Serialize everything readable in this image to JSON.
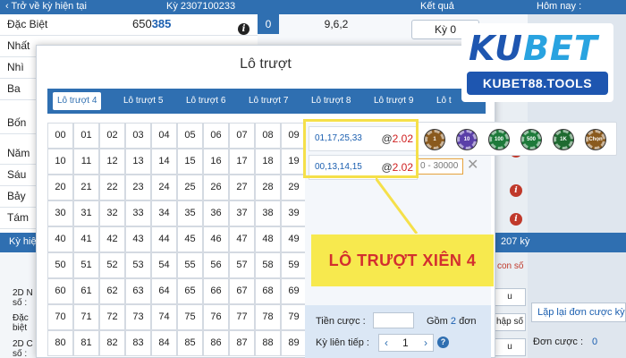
{
  "topbar": {
    "back_label": "Trở về kỳ hiện tại",
    "period_label": "Kỳ 2307100233",
    "result_label": "Kết quả",
    "today_label": "Hôm nay :"
  },
  "results": {
    "rows": [
      {
        "label": "Đặc Biệt",
        "number_plain": "650",
        "number_bold": "385"
      },
      {
        "label": "Nhất",
        "number_plain": "",
        "number_bold": ""
      },
      {
        "label": "Nhì",
        "number_plain": "",
        "number_bold": ""
      },
      {
        "label": "Ba",
        "number_plain": "",
        "number_bold": ""
      },
      {
        "label": "Bốn",
        "number_plain": "",
        "number_bold": ""
      },
      {
        "label": "Năm",
        "number_plain": "",
        "number_bold": ""
      },
      {
        "label": "Sáu",
        "number_plain": "",
        "number_bold": ""
      },
      {
        "label": "Bảy",
        "number_plain": "",
        "number_bold": ""
      },
      {
        "label": "Tám",
        "number_plain": "",
        "number_bold": ""
      }
    ]
  },
  "mid": {
    "index": "0",
    "value": "9,6,2"
  },
  "right": {
    "button": "Kỳ 0"
  },
  "strip": {
    "left": "Kỳ hiệ",
    "right": "207 kỳ"
  },
  "lower": {
    "labels": [
      "2D N",
      "số :",
      "Đặc",
      "biệt",
      "2D C",
      "số :"
    ],
    "con_so": "con số",
    "nhap_so": "hập số"
  },
  "repeat_button": "Lặp lại đơn cược kỳ t",
  "don_cuoc": {
    "label": "Đơn cược :",
    "value": "0"
  },
  "modal": {
    "title": "Lô trượt",
    "tabs": [
      "Lô trượt 4",
      "Lô trượt 5",
      "Lô trượt 6",
      "Lô trượt 7",
      "Lô trượt 8",
      "Lô trượt 9",
      "Lô t"
    ],
    "active_tab": 0,
    "numbers": [
      "00",
      "01",
      "02",
      "03",
      "04",
      "05",
      "06",
      "07",
      "08",
      "09",
      "10",
      "11",
      "12",
      "13",
      "14",
      "15",
      "16",
      "17",
      "18",
      "19",
      "20",
      "21",
      "22",
      "23",
      "24",
      "25",
      "26",
      "27",
      "28",
      "29",
      "30",
      "31",
      "32",
      "33",
      "34",
      "35",
      "36",
      "37",
      "38",
      "39",
      "40",
      "41",
      "42",
      "43",
      "44",
      "45",
      "46",
      "47",
      "48",
      "49",
      "50",
      "51",
      "52",
      "53",
      "54",
      "55",
      "56",
      "57",
      "58",
      "59",
      "60",
      "61",
      "62",
      "63",
      "64",
      "65",
      "66",
      "67",
      "68",
      "69",
      "70",
      "71",
      "72",
      "73",
      "74",
      "75",
      "76",
      "77",
      "78",
      "79",
      "80",
      "81",
      "82",
      "83",
      "84",
      "85",
      "86",
      "87",
      "88",
      "89"
    ],
    "combos": [
      {
        "numbers": "01,17,25,33",
        "at": "@",
        "odds": "2.02"
      },
      {
        "numbers": "00,13,14,15",
        "at": "@",
        "odds": "2.02"
      }
    ],
    "stake_label": "Tiền cược :",
    "stake_value": "",
    "gom_prefix": "Gồm",
    "gom_count": "2",
    "gom_suffix": "đơn",
    "ky_label": "Kỳ liên tiếp :",
    "ky_value": "1",
    "minus": "‹",
    "plus": "›"
  },
  "chips": [
    {
      "label": "1",
      "color": "#8a5a1e"
    },
    {
      "label": "10",
      "color": "#5a3fa8"
    },
    {
      "label": "100",
      "color": "#1e7a3a"
    },
    {
      "label": "500",
      "color": "#1e7a3a"
    },
    {
      "label": "1K",
      "color": "#1e6a30"
    },
    {
      "label": "Chọn",
      "color": "#8a5a1e"
    }
  ],
  "range_text": "0 - 30000",
  "close_symbol": "✕",
  "callout": "LÔ TRƯỢT XIÊN 4",
  "logo": {
    "part1": "KU",
    "part2": "BET",
    "sub": "KUBET88.TOOLS"
  },
  "colors": {
    "primary": "#2f6fb1",
    "highlight": "#f7e94e",
    "odds": "#d02020"
  }
}
